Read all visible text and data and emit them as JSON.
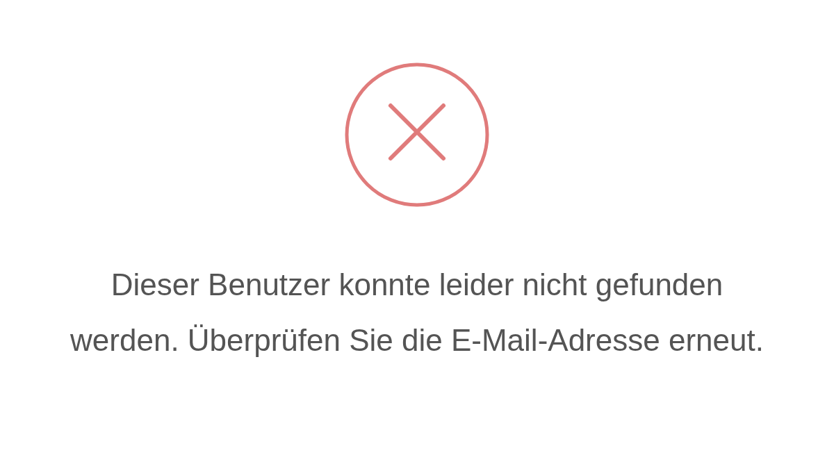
{
  "dialog": {
    "kind": "error",
    "message": "Dieser Benutzer konnte leider nicht gefunden werden. Überprüfen Sie die E-Mail-Adresse erneut."
  }
}
